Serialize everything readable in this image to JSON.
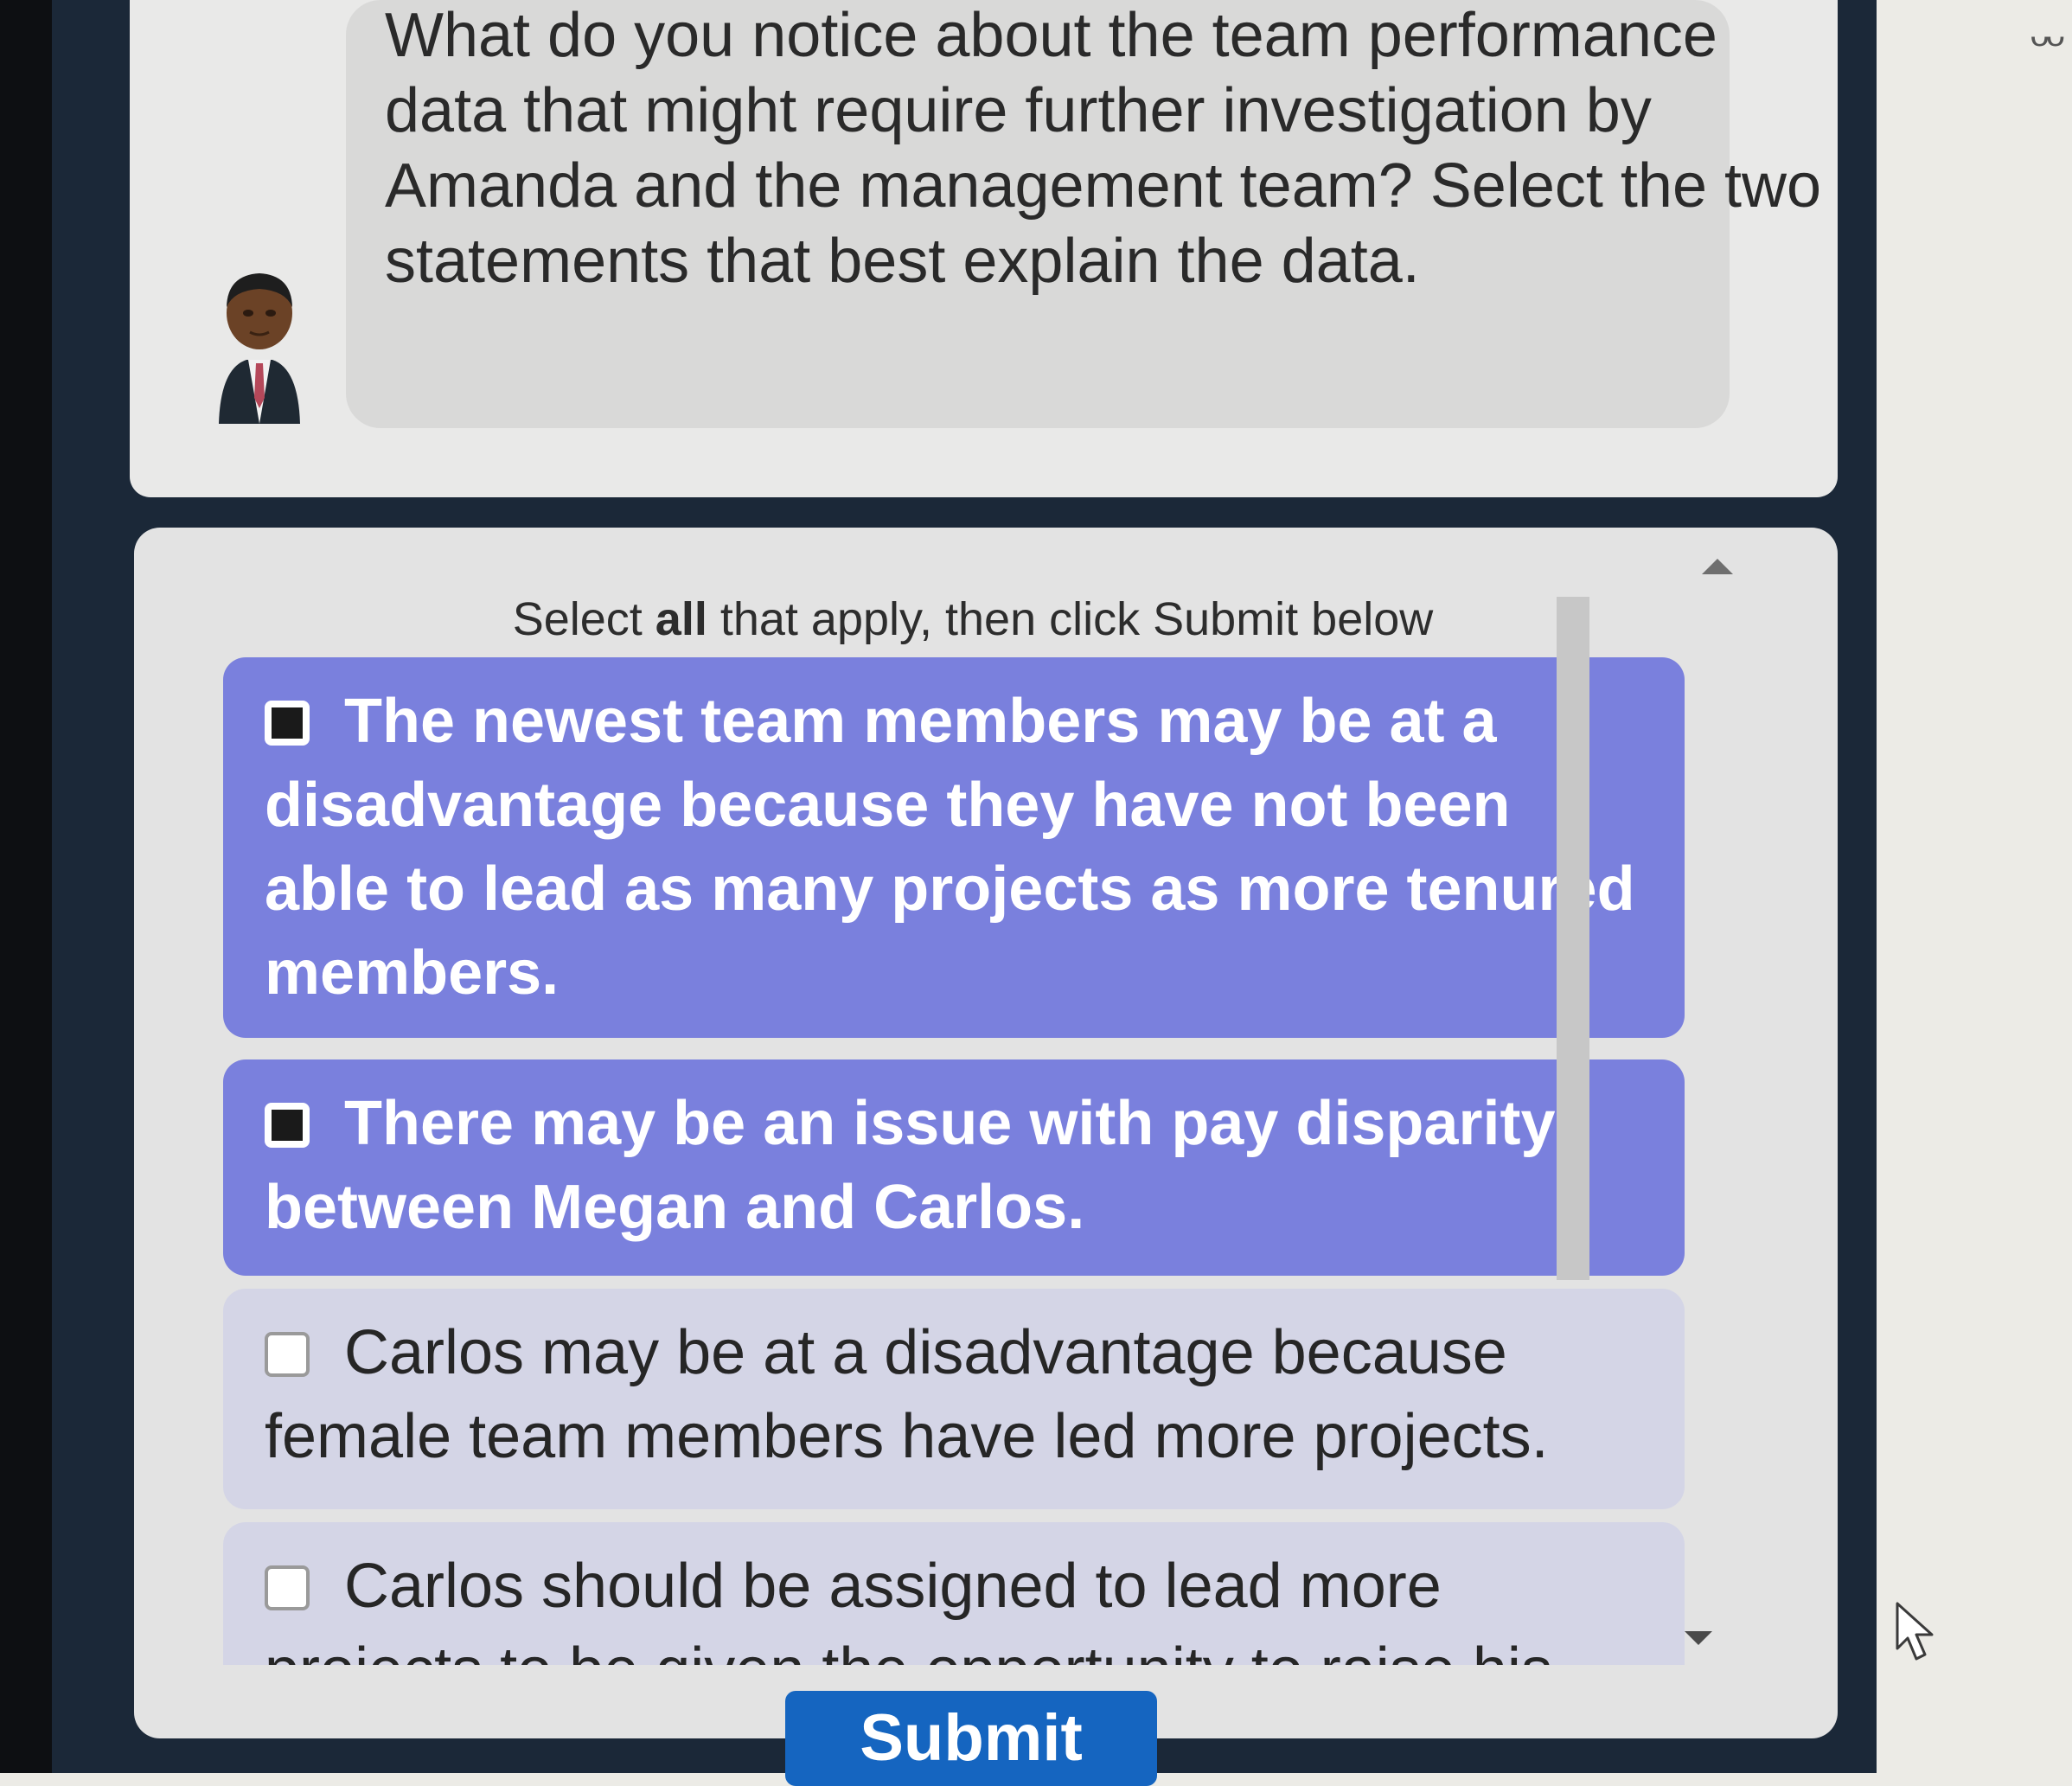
{
  "question": {
    "text": "What do you notice about the team performance data that might require further investigation by Amanda and the management team? Select the two statements that best explain the data."
  },
  "instructions": {
    "prefix": "Select ",
    "emphasis": "all",
    "suffix": " that apply, then click Submit below"
  },
  "options": [
    {
      "text": "The newest team members may be at a disadvantage because they have not been able to lead as many projects as more tenured members.",
      "selected": true
    },
    {
      "text": "There may be an issue with pay disparity between Megan and Carlos.",
      "selected": true
    },
    {
      "text": "Carlos may be at a disadvantage because female team members have led more projects.",
      "selected": false
    },
    {
      "text": "Carlos should be assigned to lead more projects to be given the opportunity to raise his",
      "selected": false
    }
  ],
  "submit": {
    "label": "Submit"
  },
  "colors": {
    "selected_option": "#7a80dd",
    "unselected_option": "#d4d5e6",
    "submit_button": "#1565c0",
    "frame": "#1b2838"
  },
  "icons": {
    "avatar": "person-avatar-icon",
    "scroll_up": "scroll-up-arrow-icon",
    "scroll_down": "scroll-down-arrow-icon",
    "cursor": "mouse-pointer-icon"
  }
}
